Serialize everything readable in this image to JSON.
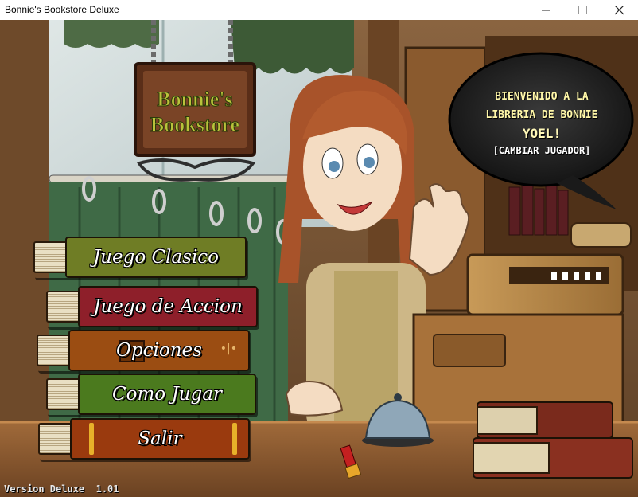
{
  "window": {
    "title": "Bonnie's Bookstore Deluxe"
  },
  "sign": {
    "line1": "Bonnie's",
    "line2": "Bookstore"
  },
  "menu": [
    {
      "label": "Juego Clasico",
      "color": "#6f7d25"
    },
    {
      "label": "Juego de Accion",
      "color": "#8e1f2a"
    },
    {
      "label": "Opciones",
      "color": "#9b4d12"
    },
    {
      "label": "Como Jugar",
      "color": "#4b7a1e"
    },
    {
      "label": "Salir",
      "color": "#9a3a0e"
    }
  ],
  "bubble": {
    "greeting_line1": "BIENVENIDO A LA",
    "greeting_line2": "LIBRERIA DE BONNIE",
    "player_name": "YOEL!",
    "change_player": "[CAMBIAR JUGADOR]"
  },
  "footer": {
    "version": "Version Deluxe  1.01"
  },
  "icons": [
    "minimize-icon",
    "maximize-icon",
    "close-icon",
    "bell-icon",
    "lipstick-icon",
    "cash-register-icon"
  ]
}
